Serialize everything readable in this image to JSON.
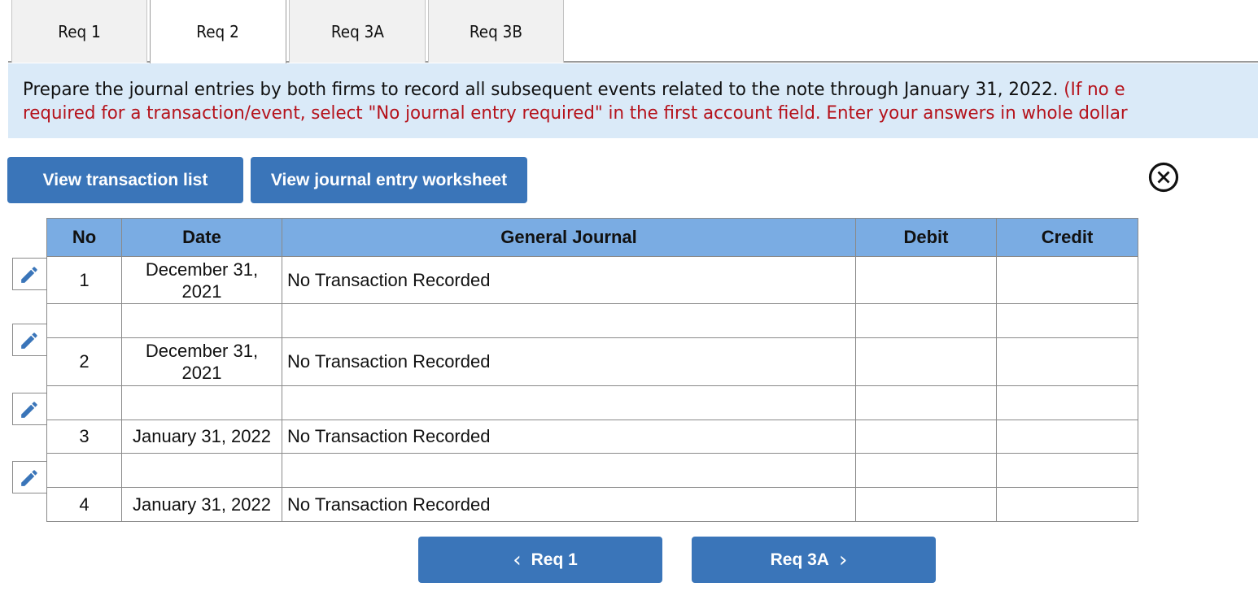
{
  "tabs": [
    {
      "label": "Req 1",
      "active": false
    },
    {
      "label": "Req 2",
      "active": true
    },
    {
      "label": "Req 3A",
      "active": false
    },
    {
      "label": "Req 3B",
      "active": false
    }
  ],
  "instructions": {
    "line1_black": "Prepare the journal entries by both firms to record all subsequent events related to the note through January 31, 2022. ",
    "line1_red": "(If no e",
    "line2_red": "required for a transaction/event, select \"No journal entry required\" in the first account field. Enter your answers in whole dollar",
    "text_color": "#111111",
    "emphasis_color": "#b5121b"
  },
  "toolbar": {
    "view_transaction_list": "View transaction list",
    "view_journal_entry_worksheet": "View journal entry worksheet",
    "close_icon": "circle-x-icon"
  },
  "table": {
    "headers": {
      "no": "No",
      "date": "Date",
      "general_journal": "General Journal",
      "debit": "Debit",
      "credit": "Credit"
    },
    "header_color": "#7aace3",
    "rows": [
      {
        "no": "1",
        "date_line1": "December 31,",
        "date_line2": "2021",
        "account": "No Transaction Recorded",
        "debit": "",
        "credit": ""
      },
      {
        "no": "",
        "date_line1": "",
        "date_line2": "",
        "account": "",
        "debit": "",
        "credit": ""
      },
      {
        "no": "2",
        "date_line1": "December 31,",
        "date_line2": "2021",
        "account": "No Transaction Recorded",
        "debit": "",
        "credit": ""
      },
      {
        "no": "",
        "date_line1": "",
        "date_line2": "",
        "account": "",
        "debit": "",
        "credit": ""
      },
      {
        "no": "3",
        "date_line1": "January 31, 2022",
        "date_line2": "",
        "account": "No Transaction Recorded",
        "debit": "",
        "credit": ""
      },
      {
        "no": "",
        "date_line1": "",
        "date_line2": "",
        "account": "",
        "debit": "",
        "credit": ""
      },
      {
        "no": "4",
        "date_line1": "January 31, 2022",
        "date_line2": "",
        "account": "No Transaction Recorded",
        "debit": "",
        "credit": ""
      }
    ],
    "edit_icon": "pencil-icon"
  },
  "navigation": {
    "prev_label": "Req 1",
    "next_label": "Req 3A",
    "prev_icon": "chevron-left-icon",
    "next_icon": "chevron-right-icon",
    "prev_glyph": "‹",
    "next_glyph": "›"
  },
  "colors": {
    "button": "#3a75b9",
    "info_background": "#daeaf8",
    "icon_blue": "#3a75b9"
  }
}
